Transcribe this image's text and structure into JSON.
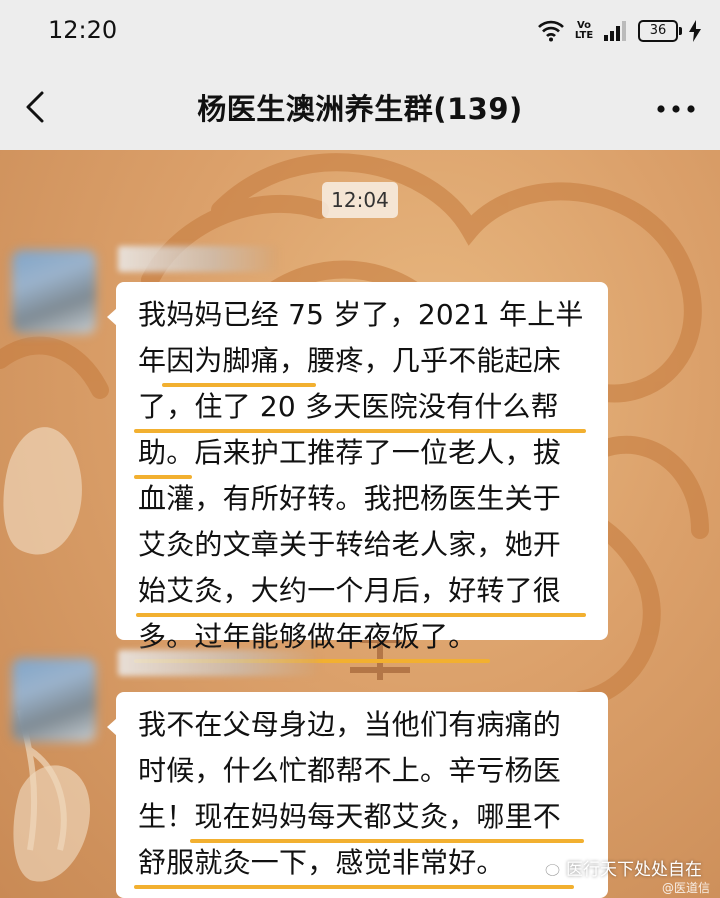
{
  "status_bar": {
    "time": "12:20",
    "network_label": "Vo LTE",
    "battery_level": "36"
  },
  "header": {
    "title": "杨医生澳洲养生群(139)"
  },
  "chat": {
    "timestamp": "12:04",
    "messages": [
      {
        "text": "我妈妈已经 75 岁了，2021 年上半年因为脚痛，腰疼，几乎不能起床了，住了 20 多天医院没有什么帮助。后来护工推荐了一位老人，拔血灌，有所好转。我把杨医生关于艾灸的文章关于转给老人家，她开始艾灸，大约一个月后，好转了很多。过年能够做年夜饭了。"
      },
      {
        "text": "我不在父母身边，当他们有病痛的时候，什么忙都帮不上。辛亏杨医生！现在妈妈每天都艾灸，哪里不舒服就灸一下，感觉非常好。"
      }
    ]
  },
  "watermark": {
    "text": "医行天下处处自在",
    "sub": "@医道信"
  },
  "colors": {
    "highlight": "#f2b030",
    "top_bar": "#ededed",
    "bubble": "#ffffff"
  },
  "icons": [
    "wifi-icon",
    "signal-icon",
    "battery-icon",
    "charging-icon",
    "back-arrow-icon",
    "more-options-icon",
    "wechat-icon"
  ]
}
